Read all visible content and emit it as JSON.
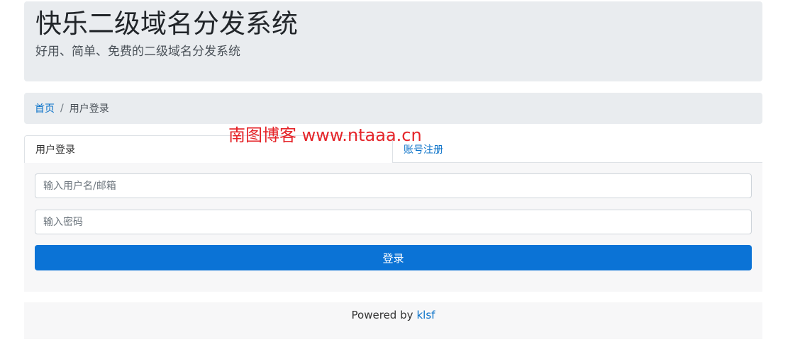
{
  "header": {
    "title": "快乐二级域名分发系统",
    "subtitle": "好用、简单、免费的二级域名分发系统"
  },
  "breadcrumb": {
    "home": "首页",
    "separator": "/",
    "current": "用户登录"
  },
  "watermark": "南图博客 www.ntaaa.cn",
  "tabs": [
    {
      "label": "用户登录",
      "active": true
    },
    {
      "label": "账号注册",
      "active": false
    }
  ],
  "form": {
    "username_placeholder": "输入用户名/邮箱",
    "password_placeholder": "输入密码",
    "submit_label": "登录"
  },
  "footer": {
    "powered_text": "Powered by",
    "link_text": "klsf"
  },
  "colors": {
    "primary": "#0b73d6",
    "link": "#0a72c9",
    "watermark": "#e5252a",
    "panel_bg": "#e9ecef"
  }
}
